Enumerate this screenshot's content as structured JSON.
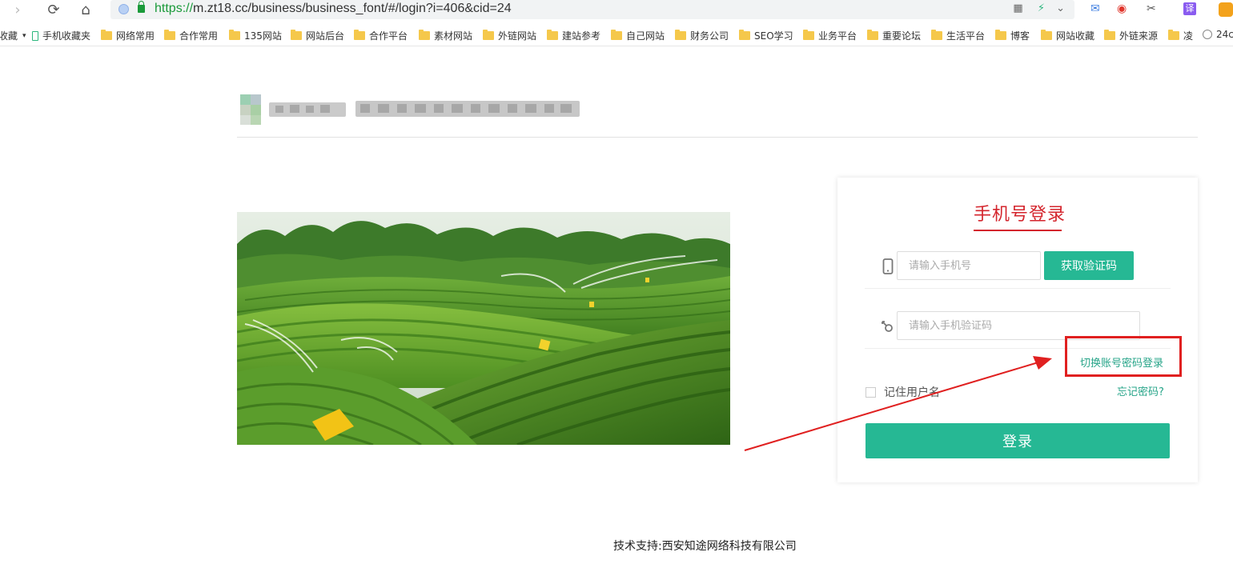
{
  "browser": {
    "url_scheme": "https://",
    "url_rest": "m.zt18.cc/business/business_font/#/login?i=406&cid=24",
    "ext_translate": "译",
    "bookmarks": [
      {
        "label": "收藏",
        "type": "dropdown"
      },
      {
        "label": "手机收藏夹",
        "type": "phone"
      },
      {
        "label": "网络常用",
        "type": "folder"
      },
      {
        "label": "合作常用",
        "type": "folder"
      },
      {
        "label": "135网站",
        "type": "folder"
      },
      {
        "label": "网站后台",
        "type": "folder"
      },
      {
        "label": "合作平台",
        "type": "folder"
      },
      {
        "label": "素材网站",
        "type": "folder"
      },
      {
        "label": "外链网站",
        "type": "folder"
      },
      {
        "label": "建站参考",
        "type": "folder"
      },
      {
        "label": "自己网站",
        "type": "folder"
      },
      {
        "label": "财务公司",
        "type": "folder"
      },
      {
        "label": "SEO学习",
        "type": "folder"
      },
      {
        "label": "业务平台",
        "type": "folder"
      },
      {
        "label": "重要论坛",
        "type": "folder"
      },
      {
        "label": "生活平台",
        "type": "folder"
      },
      {
        "label": "博客",
        "type": "folder"
      },
      {
        "label": "网站收藏",
        "type": "folder"
      },
      {
        "label": "外链来源",
        "type": "folder"
      },
      {
        "label": "凌",
        "type": "folder"
      },
      {
        "label": "24c",
        "type": "world"
      }
    ]
  },
  "login": {
    "title": "手机号登录",
    "phone_placeholder": "请输入手机号",
    "sms_button": "获取验证码",
    "code_placeholder": "请输入手机验证码",
    "switch_link": "切换账号密码登录",
    "remember_label": "记住用户名",
    "forgot_link": "忘记密码?",
    "submit": "登录"
  },
  "footer": {
    "text": "技术支持:西安知途网络科技有限公司"
  },
  "colors": {
    "accent": "#26b894",
    "title_red": "#d4252d",
    "annotation_red": "#e02020"
  }
}
